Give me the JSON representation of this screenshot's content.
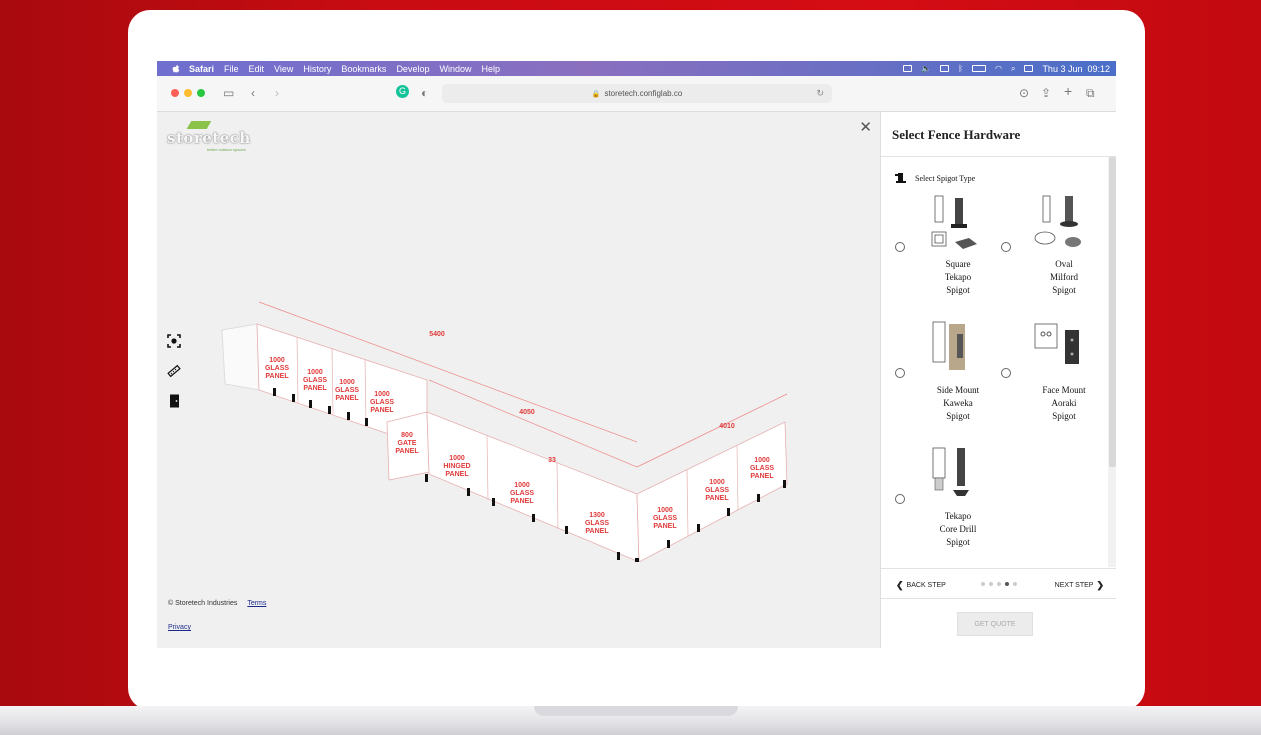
{
  "menubar": {
    "app": "Safari",
    "items": [
      "File",
      "Edit",
      "View",
      "History",
      "Bookmarks",
      "Develop",
      "Window",
      "Help"
    ],
    "clock": "Thu 3 Jun  09:12"
  },
  "browser": {
    "url": "storetech.configlab.co"
  },
  "viewport": {
    "logo": "storetech",
    "logo_tagline": "better outdoor spaces",
    "copyright": "© Storetech Industries",
    "terms": "Terms",
    "privacy": "Privacy",
    "tools": [
      "focus-icon",
      "ruler-icon",
      "door-icon"
    ]
  },
  "scene_labels": {
    "gate": "800\nGATE\nPANEL",
    "hinged": "1000\nHINGED\nPANEL",
    "glass1": "1000\nGLASS\nPANEL",
    "glass2": "1300\nGLASS\nPANEL",
    "glass3": "1000\nGLASS\nPANEL",
    "glass4": "1000\nGLASS\nPANEL",
    "glass5": "1000\nGLASS\nPANEL",
    "left1": "1000\nGLASS\nPANEL",
    "left2": "1000\nGLASS\nPANEL",
    "left3": "1000\nGLASS\nPANEL",
    "left4": "1000\nGLASS\nPANEL",
    "dim_long": "5400",
    "dim_mid": "4050",
    "dim_right": "4010",
    "gap": "33"
  },
  "panel": {
    "title": "Select Fence Hardware",
    "step_label": "Select Spigot Type",
    "options": [
      {
        "label": "Square\nTekapo\nSpigot"
      },
      {
        "label": "Oval\nMilford\nSpigot"
      },
      {
        "label": "Side Mount\nKaweka\nSpigot"
      },
      {
        "label": "Face Mount\nAoraki\nSpigot"
      },
      {
        "label": "Tekapo\nCore Drill\nSpigot"
      }
    ],
    "back": "BACK STEP",
    "next": "NEXT STEP",
    "quote": "GET QUOTE",
    "current_step": 4,
    "total_steps": 5
  }
}
